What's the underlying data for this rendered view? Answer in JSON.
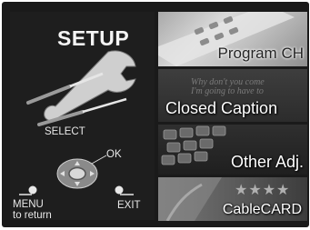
{
  "setup_panel": {
    "title": "SETUP",
    "remote": {
      "select_label": "SELECT",
      "ok_label": "OK",
      "menu_label": "MENU",
      "menu_sub_label": "to return",
      "exit_label": "EXIT"
    }
  },
  "menu_tiles": [
    {
      "label": "Program CH",
      "icon": "remote-control-image"
    },
    {
      "label": "Closed Caption",
      "icon": "caption-text-image",
      "caption_line_1": "Why don't you come",
      "caption_line_2": "I'm going to have to"
    },
    {
      "label": "Other Adj.",
      "icon": "keyboard-keys-image"
    },
    {
      "label": "CableCARD",
      "icon": "cablecard-image",
      "decor": "★★★★"
    }
  ]
}
